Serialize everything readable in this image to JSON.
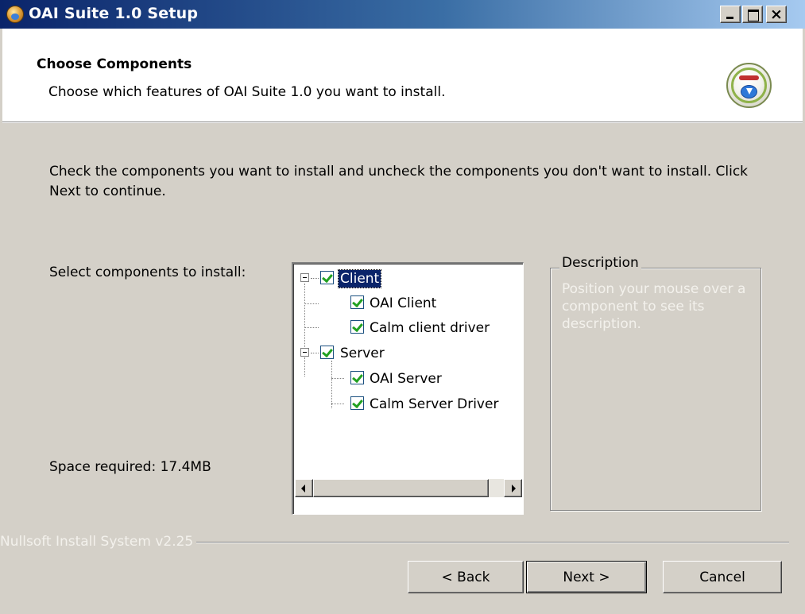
{
  "window": {
    "title": "OAI Suite 1.0 Setup",
    "icon": "installer-icon",
    "controls": {
      "minimize": "minimize",
      "maximize": "maximize",
      "close": "×"
    }
  },
  "header": {
    "title": "Choose Components",
    "subtitle": "Choose which features of OAI Suite 1.0 you want to install.",
    "icon": "install-disc-icon"
  },
  "body": {
    "instructions": "Check the components you want to install and uncheck the components you don't want to install. Click Next to continue.",
    "select_label": "Select components to install:",
    "space_required": "Space required: 17.4MB"
  },
  "components": [
    {
      "label": "Client",
      "checked": true,
      "expanded": true,
      "selected": true,
      "children": [
        {
          "label": "OAI Client",
          "checked": true
        },
        {
          "label": "Calm client driver",
          "checked": true
        }
      ]
    },
    {
      "label": "Server",
      "checked": true,
      "expanded": true,
      "children": [
        {
          "label": "OAI Server",
          "checked": true
        },
        {
          "label": "Calm Server Driver",
          "checked": true
        }
      ]
    }
  ],
  "description": {
    "legend": "Description",
    "text": "Position your mouse over a component to see its description."
  },
  "branding": "Nullsoft Install System v2.25",
  "buttons": {
    "back": "< Back",
    "next": "Next >",
    "cancel": "Cancel"
  },
  "colors": {
    "titlebar_start": "#0a246a",
    "titlebar_end": "#a6caf0",
    "dialog_face": "#d4d0c8",
    "selection": "#0a246a",
    "check": "#21a121"
  }
}
